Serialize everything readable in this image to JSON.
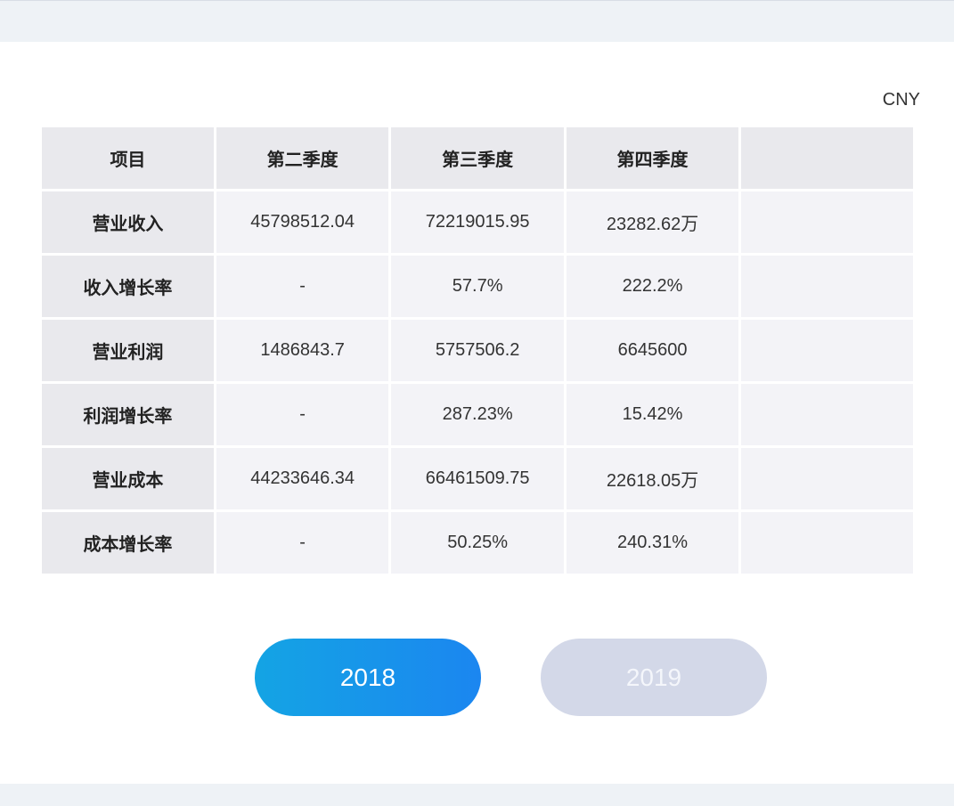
{
  "currency": "CNY",
  "table": {
    "headers": [
      "项目",
      "第二季度",
      "第三季度",
      "第四季度",
      ""
    ],
    "rows": [
      {
        "label": "营业收入",
        "q2": "45798512.04",
        "q3": "72219015.95",
        "q4": "23282.62万"
      },
      {
        "label": "收入增长率",
        "q2": "-",
        "q3": "57.7%",
        "q4": "222.2%"
      },
      {
        "label": "营业利润",
        "q2": "1486843.7",
        "q3": "5757506.2",
        "q4": "6645600"
      },
      {
        "label": "利润增长率",
        "q2": "-",
        "q3": "287.23%",
        "q4": "15.42%"
      },
      {
        "label": "营业成本",
        "q2": "44233646.34",
        "q3": "66461509.75",
        "q4": "22618.05万"
      },
      {
        "label": "成本增长率",
        "q2": "-",
        "q3": "50.25%",
        "q4": "240.31%"
      }
    ]
  },
  "year_buttons": {
    "selected": "2018",
    "items": [
      {
        "label": "2018",
        "active": true,
        "color": "#1b86f0"
      },
      {
        "label": "2019",
        "active": false,
        "color": "#d3d8e8"
      }
    ]
  }
}
